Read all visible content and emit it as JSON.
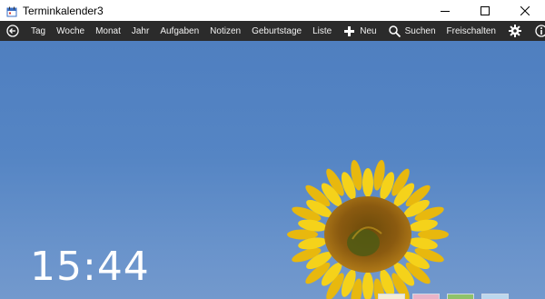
{
  "window": {
    "title": "Terminkalender3"
  },
  "toolbar": {
    "items": [
      "Tag",
      "Woche",
      "Monat",
      "Jahr",
      "Aufgaben",
      "Notizen",
      "Geburtstage",
      "Liste",
      "Neu",
      "Suchen",
      "Freischalten"
    ]
  },
  "clock": {
    "time": "15:44"
  },
  "colors": {
    "toolbar_bg": "#2b2b2b",
    "sky": "#5585c4",
    "petal": "#f5d21a",
    "disk": "#8a5a10"
  },
  "icons": [
    "calendar-icon",
    "minimize-icon",
    "maximize-icon",
    "close-icon",
    "back-arrow-icon",
    "plus-icon",
    "search-icon",
    "gear-icon",
    "info-icon"
  ]
}
